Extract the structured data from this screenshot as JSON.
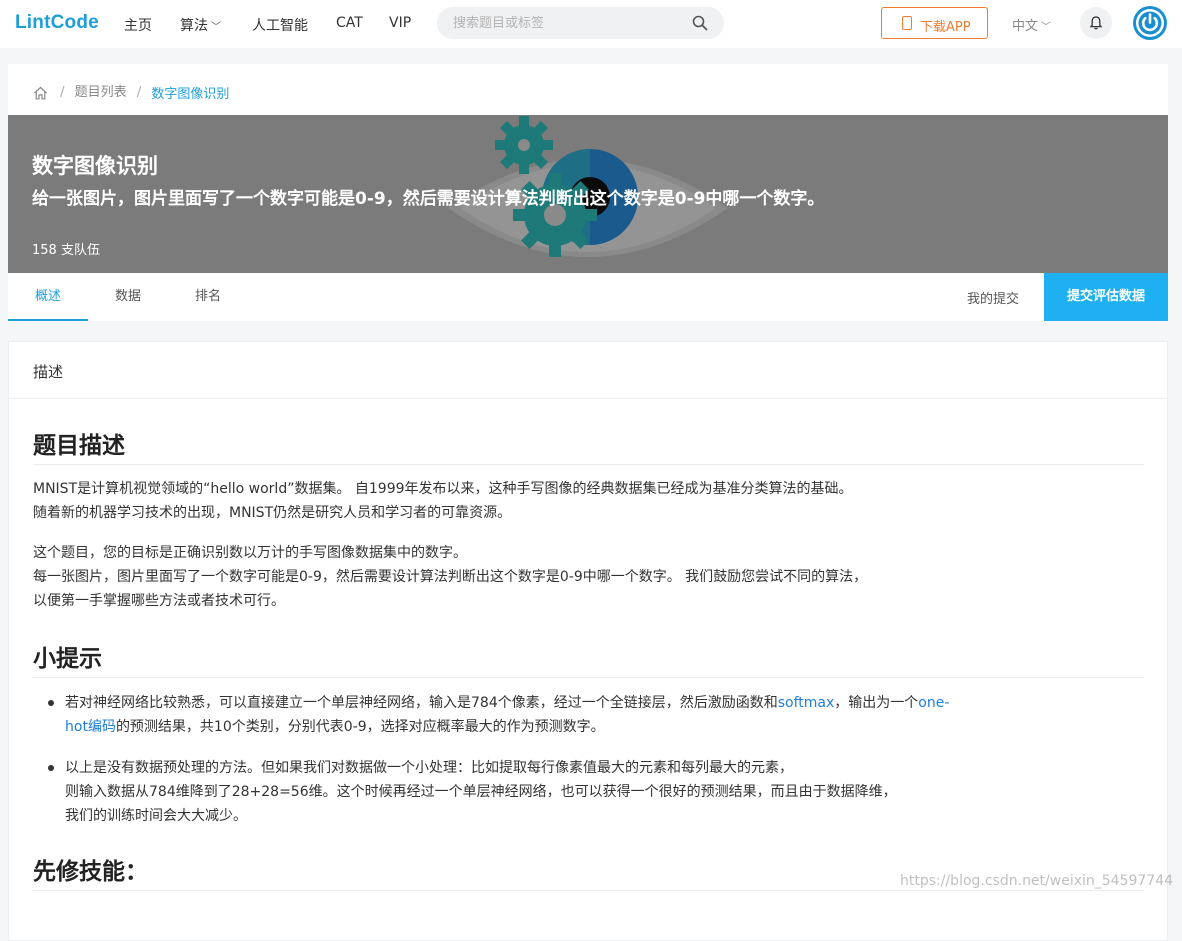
{
  "nav": {
    "logo": "LintCode",
    "links": [
      "主页",
      "算法",
      "人工智能",
      "CAT",
      "VIP"
    ],
    "search_placeholder": "搜索题目或标签",
    "download_label": "下载APP",
    "language": "中文"
  },
  "breadcrumb": {
    "items": [
      "题目列表",
      "数字图像识别"
    ]
  },
  "banner": {
    "title": "数字图像识别",
    "description": "给一张图片，图片里面写了一个数字可能是0-9，然后需要设计算法判断出这个数字是0-9中哪一个数字。",
    "teams": "158 支队伍"
  },
  "tabs": {
    "items": [
      "概述",
      "数据",
      "排名"
    ],
    "active": "概述",
    "my_submissions": "我的提交",
    "submit_label": "提交评估数据"
  },
  "content": {
    "section_label": "描述",
    "heading1": "题目描述",
    "para1_line1": "MNIST是计算机视觉领域的“hello world”数据集。 自1999年发布以来，这种手写图像的经典数据集已经成为基准分类算法的基础。",
    "para1_line2": "随着新的机器学习技术的出现，MNIST仍然是研究人员和学习者的可靠资源。",
    "para2_line1": "这个题目，您的目标是正确识别数以万计的手写图像数据集中的数字。",
    "para2_line2": "每一张图片，图片里面写了一个数字可能是0-9，然后需要设计算法判断出这个数字是0-9中哪一个数字。 我们鼓励您尝试不同的算法，",
    "para2_line3": "以便第一手掌握哪些方法或者技术可行。",
    "heading2": "小提示",
    "tip1_a": "若对神经网络比较熟悉，可以直接建立一个单层神经网络，输入是784个像素，经过一个全链接层，然后激励函数和",
    "tip1_link1": "softmax",
    "tip1_b": "，输出为一个",
    "tip1_link2a": "one-",
    "tip1_link2b": "hot编码",
    "tip1_c": "的预测结果，共10个类别，分别代表0-9，选择对应概率最大的作为预测数字。",
    "tip2_line1": "以上是没有数据预处理的方法。但如果我们对数据做一个小处理：比如提取每行像素值最大的元素和每列最大的元素，",
    "tip2_line2": "则输入数据从784维降到了28+28=56维。这个时候再经过一个单层神经网络，也可以获得一个很好的预测结果，而且由于数据降维，",
    "tip2_line3": "我们的训练时间会大大减少。",
    "heading3": "先修技能："
  },
  "watermark": "https://blog.csdn.net/weixin_54597744",
  "colors": {
    "brand": "#1e9fd8",
    "download": "#f07c33",
    "submit_bg": "#1eb0f0",
    "banner_bg": "#7b7b7b",
    "gear": "#1d7a78"
  }
}
